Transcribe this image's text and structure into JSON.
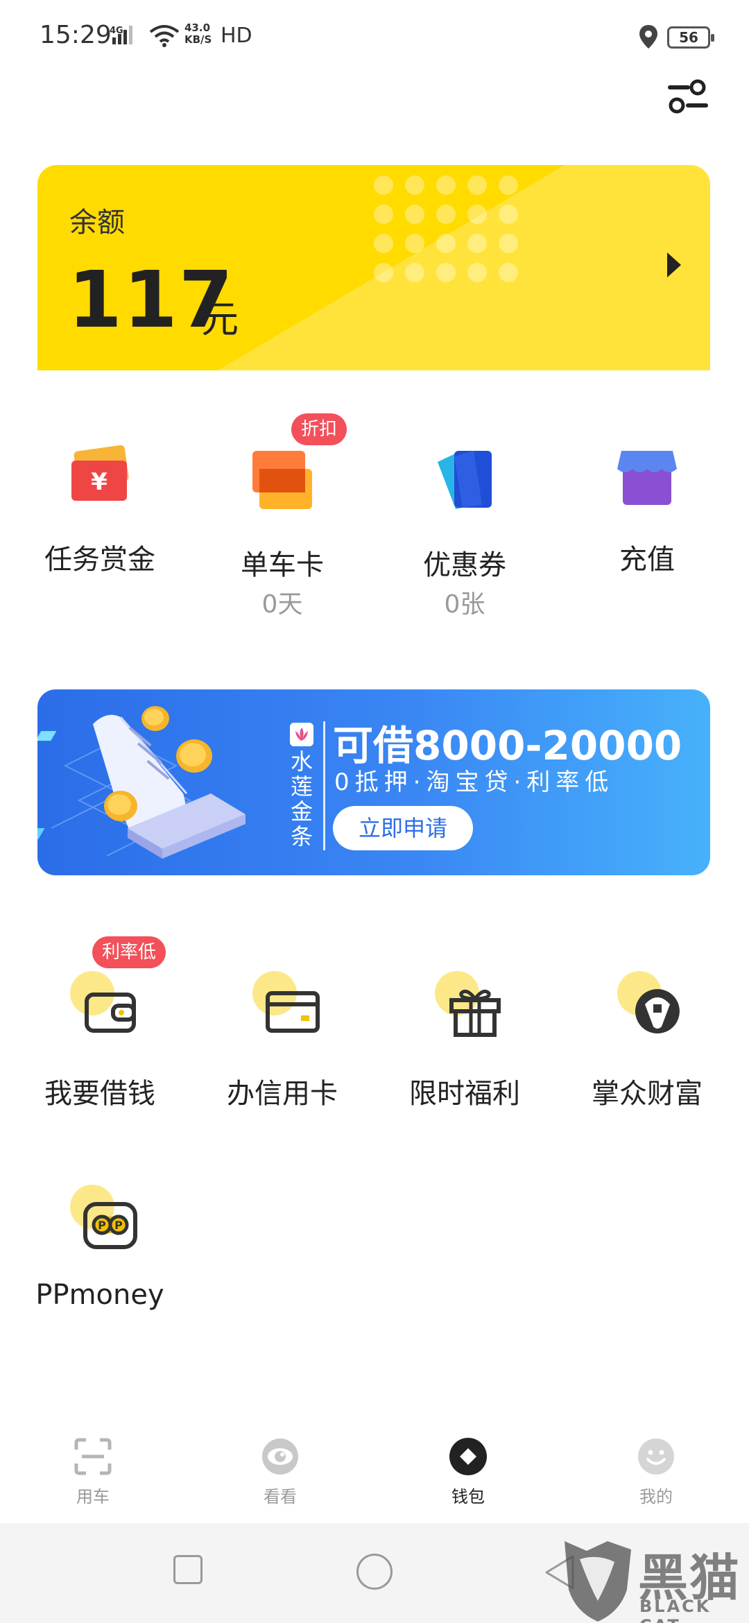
{
  "status_bar": {
    "time": "15:29",
    "network": "4G",
    "speed_value": "43.0",
    "speed_unit": "KB/S",
    "hd": "HD",
    "battery": "56"
  },
  "balance": {
    "label": "余额",
    "amount": "117",
    "unit": "元"
  },
  "quick_items": [
    {
      "label": "任务赏金",
      "sub": "",
      "icon": "task-reward-icon"
    },
    {
      "label": "单车卡",
      "sub": "0天",
      "badge": "折扣",
      "icon": "bike-card-icon"
    },
    {
      "label": "优惠券",
      "sub": "0张",
      "icon": "coupon-icon"
    },
    {
      "label": "充值",
      "sub": "",
      "icon": "recharge-icon"
    }
  ],
  "ad_banner": {
    "brand": "水莲金条",
    "title": "可借8000-20000",
    "subtitle": "0抵押·淘宝贷·利率低",
    "cta": "立即申请"
  },
  "services": [
    {
      "label": "我要借钱",
      "badge": "利率低",
      "icon": "wallet-icon"
    },
    {
      "label": "办信用卡",
      "icon": "credit-card-icon"
    },
    {
      "label": "限时福利",
      "icon": "gift-icon"
    },
    {
      "label": "掌众财富",
      "icon": "wealth-icon"
    },
    {
      "label": "PPmoney",
      "icon": "ppmoney-icon"
    }
  ],
  "bottom_nav": [
    {
      "label": "用车",
      "icon": "scan-icon",
      "active": false
    },
    {
      "label": "看看",
      "icon": "eye-icon",
      "active": false
    },
    {
      "label": "钱包",
      "icon": "wallet-diamond-icon",
      "active": true
    },
    {
      "label": "我的",
      "icon": "smiley-icon",
      "active": false
    }
  ],
  "watermark": {
    "cn": "黑猫",
    "en": "BLACK CAT"
  },
  "colors": {
    "card_yellow": "#ffe33a",
    "banner_blue": "#2b6de8",
    "badge_red": "#f2505a",
    "accent_circle": "#fde889"
  }
}
